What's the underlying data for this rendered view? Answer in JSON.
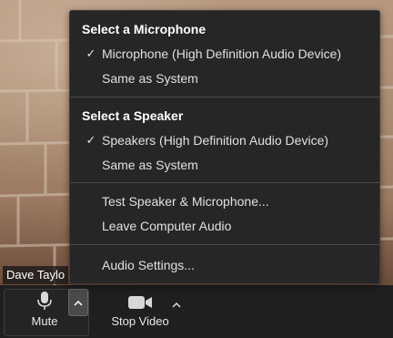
{
  "video": {
    "participant_name": "Dave Taylo"
  },
  "menu": {
    "microphone_header": "Select a Microphone",
    "microphones": [
      {
        "label": "Microphone (High Definition Audio Device)",
        "checked": true
      },
      {
        "label": "Same as System",
        "checked": false
      }
    ],
    "speaker_header": "Select a Speaker",
    "speakers": [
      {
        "label": "Speakers (High Definition Audio Device)",
        "checked": true
      },
      {
        "label": "Same as System",
        "checked": false
      }
    ],
    "test_label": "Test Speaker & Microphone...",
    "leave_label": "Leave Computer Audio",
    "settings_label": "Audio Settings...",
    "check_glyph": "✓"
  },
  "toolbar": {
    "mute_label": "Mute",
    "stop_video_label": "Stop Video",
    "icons": [
      "microphone-icon",
      "chevron-up-icon",
      "video-camera-icon",
      "chevron-up-icon"
    ]
  },
  "colors": {
    "menu_bg": "#262626",
    "toolbar_bg": "#1f1f1f",
    "text": "#e6e6e6"
  }
}
